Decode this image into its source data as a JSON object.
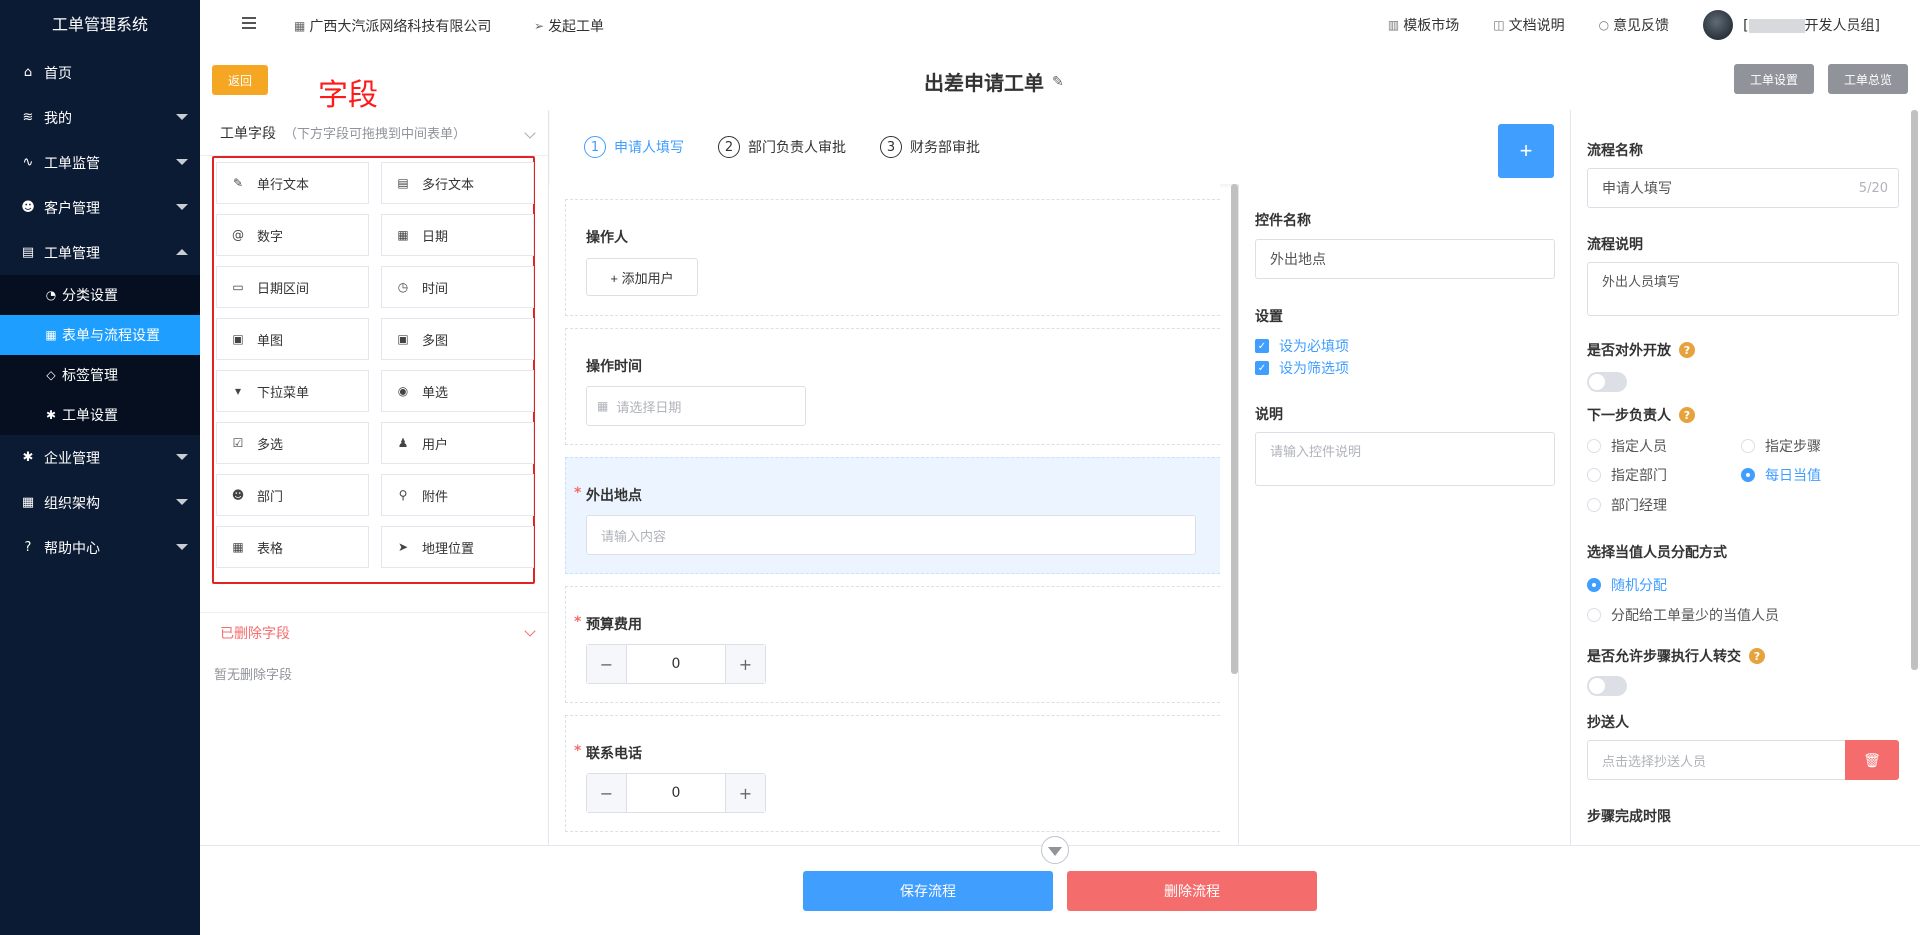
{
  "sidebar": {
    "title": "工单管理系统",
    "items": [
      {
        "label": "首页",
        "icon": "home-icon",
        "glyph": "⌂"
      },
      {
        "label": "我的",
        "icon": "layers-icon",
        "glyph": "≋"
      },
      {
        "label": "工单监管",
        "icon": "pulse-icon",
        "glyph": "∿"
      },
      {
        "label": "客户管理",
        "icon": "users-icon",
        "glyph": "☻"
      },
      {
        "label": "工单管理",
        "icon": "clipboard-icon",
        "glyph": "▤"
      },
      {
        "label": "企业管理",
        "icon": "gear-icon",
        "glyph": "✱"
      },
      {
        "label": "组织架构",
        "icon": "org-icon",
        "glyph": "▦"
      },
      {
        "label": "帮助中心",
        "icon": "question-icon",
        "glyph": "?"
      }
    ],
    "subitems": [
      {
        "label": "分类设置",
        "icon": "category-icon",
        "glyph": "◔"
      },
      {
        "label": "表单与流程设置",
        "icon": "table-icon",
        "glyph": "▦"
      },
      {
        "label": "标签管理",
        "icon": "tag-icon",
        "glyph": "◇"
      },
      {
        "label": "工单设置",
        "icon": "gear-icon",
        "glyph": "✱"
      }
    ]
  },
  "topbar": {
    "company": "广西大汽派网络科技有限公司",
    "launch": "发起工单",
    "links": [
      "模板市场",
      "文档说明",
      "意见反馈"
    ],
    "user_prefix": "[",
    "user_suffix": "开发人员组]"
  },
  "header": {
    "back_label": "返回",
    "annotation": "字段",
    "title": "出差申请工单",
    "settings_label": "工单设置",
    "overview_label": "工单总览"
  },
  "fields_panel": {
    "title": "工单字段",
    "hint": "（下方字段可拖拽到中间表单）",
    "items": [
      {
        "label": "单行文本",
        "icon": "edit-icon",
        "glyph": "✎"
      },
      {
        "label": "多行文本",
        "icon": "document-icon",
        "glyph": "▤"
      },
      {
        "label": "数字",
        "icon": "at-icon",
        "glyph": "@"
      },
      {
        "label": "日期",
        "icon": "calendar-icon",
        "glyph": "▦"
      },
      {
        "label": "日期区间",
        "icon": "calendar-range-icon",
        "glyph": "▭"
      },
      {
        "label": "时间",
        "icon": "clock-icon",
        "glyph": "◷"
      },
      {
        "label": "单图",
        "icon": "image-icon",
        "glyph": "▣"
      },
      {
        "label": "多图",
        "icon": "images-icon",
        "glyph": "▣"
      },
      {
        "label": "下拉菜单",
        "icon": "dropdown-icon",
        "glyph": "▾"
      },
      {
        "label": "单选",
        "icon": "radio-icon",
        "glyph": "◉"
      },
      {
        "label": "多选",
        "icon": "checkbox-icon",
        "glyph": "☑"
      },
      {
        "label": "用户",
        "icon": "user-icon",
        "glyph": "♟"
      },
      {
        "label": "部门",
        "icon": "group-icon",
        "glyph": "☻"
      },
      {
        "label": "附件",
        "icon": "paperclip-icon",
        "glyph": "⚲"
      },
      {
        "label": "表格",
        "icon": "table-icon",
        "glyph": "▦"
      },
      {
        "label": "地理位置",
        "icon": "location-arrow-icon",
        "glyph": "➤"
      }
    ],
    "deleted_title": "已删除字段",
    "deleted_empty": "暂无删除字段"
  },
  "steps": [
    {
      "num": "1",
      "label": "申请人填写"
    },
    {
      "num": "2",
      "label": "部门负责人审批"
    },
    {
      "num": "3",
      "label": "财务部审批"
    }
  ],
  "form": {
    "operator_label": "操作人",
    "add_user_label": "+ 添加用户",
    "op_time_label": "操作时间",
    "date_placeholder": "请选择日期",
    "location_label": "外出地点",
    "location_placeholder": "请输入内容",
    "budget_label": "预算费用",
    "budget_value": "0",
    "phone_label": "联系电话",
    "phone_value": "0",
    "required_mark": "*"
  },
  "control": {
    "name_label": "控件名称",
    "name_value": "外出地点",
    "settings_label": "设置",
    "required_check": "设为必填项",
    "filter_check": "设为筛选项",
    "desc_label": "说明",
    "desc_placeholder": "请输入控件说明"
  },
  "flow": {
    "name_label": "流程名称",
    "name_value": "申请人填写",
    "name_count": "5/20",
    "desc_label": "流程说明",
    "desc_value": "外出人员填写",
    "open_label": "是否对外开放",
    "next_label": "下一步负责人",
    "next_options": [
      "指定人员",
      "指定步骤",
      "指定部门",
      "每日当值",
      "部门经理"
    ],
    "assign_label": "选择当值人员分配方式",
    "assign_options": [
      "随机分配",
      "分配给工单量少的当值人员"
    ],
    "transfer_label": "是否允许步骤执行人转交",
    "cc_label": "抄送人",
    "cc_placeholder": "点击选择抄送人员",
    "deadline_label": "步骤完成时限"
  },
  "footer": {
    "save_label": "保存流程",
    "delete_label": "删除流程"
  },
  "colors": {
    "sidebar_bg": "#0c1b34",
    "active_blue": "#1e9fff",
    "primary": "#409eff",
    "danger": "#f56c6c",
    "warning": "#f5a623"
  }
}
